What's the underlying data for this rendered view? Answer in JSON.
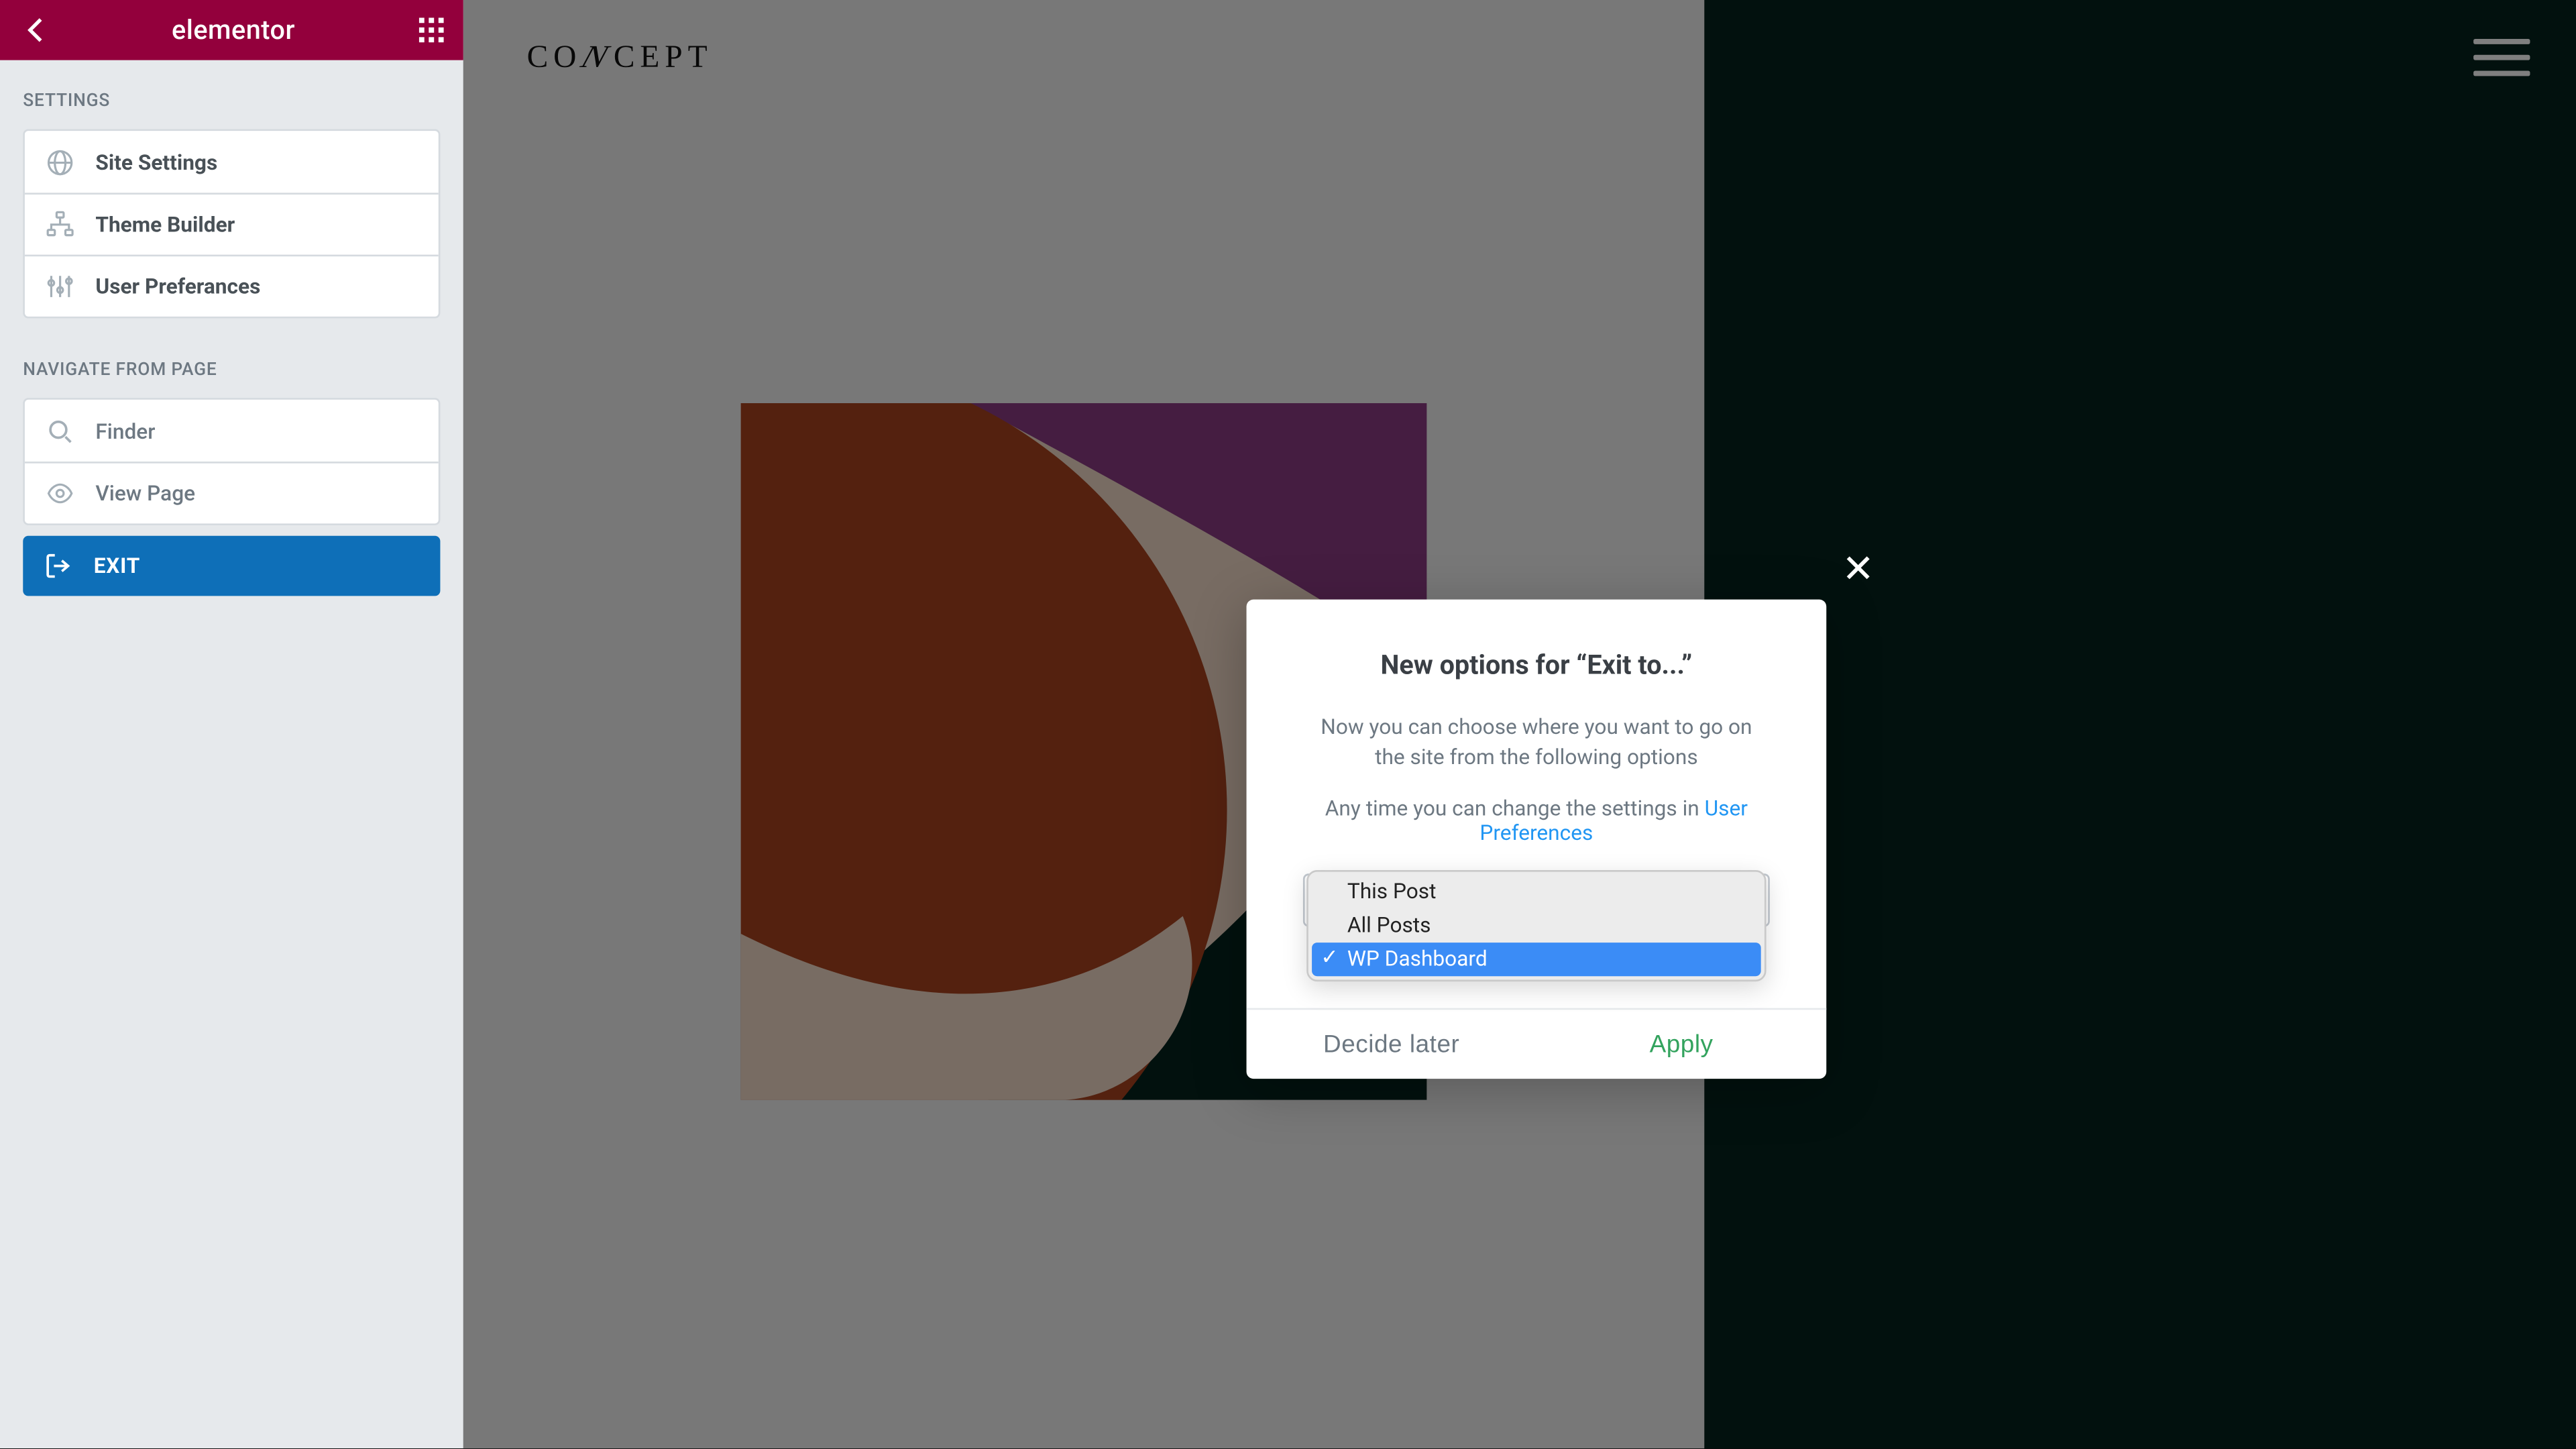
{
  "header": {
    "logo_text": "elementor"
  },
  "sidebar": {
    "sections": {
      "settings_label": "SETTINGS",
      "navigate_label": "NAVIGATE FROM PAGE"
    },
    "settings_items": [
      {
        "label": "Site Settings"
      },
      {
        "label": "Theme Builder"
      },
      {
        "label": "User Preferances"
      }
    ],
    "navigate_items": [
      {
        "label": "Finder"
      },
      {
        "label": "View Page"
      }
    ],
    "exit_label": "EXIT"
  },
  "canvas": {
    "site_logo_left": "CO",
    "site_logo_slash": "N",
    "site_logo_right": "CEPT"
  },
  "modal": {
    "title": "New options for “Exit to...”",
    "desc": "Now you can choose where you want to go on the site from the following options",
    "note_prefix": "Any time you can change the settings in ",
    "note_link": "User Preferences",
    "options": [
      {
        "label": "This Post",
        "selected": false
      },
      {
        "label": "All Posts",
        "selected": false
      },
      {
        "label": "WP Dashboard",
        "selected": true
      }
    ],
    "btn_later": "Decide later",
    "btn_apply": "Apply"
  }
}
